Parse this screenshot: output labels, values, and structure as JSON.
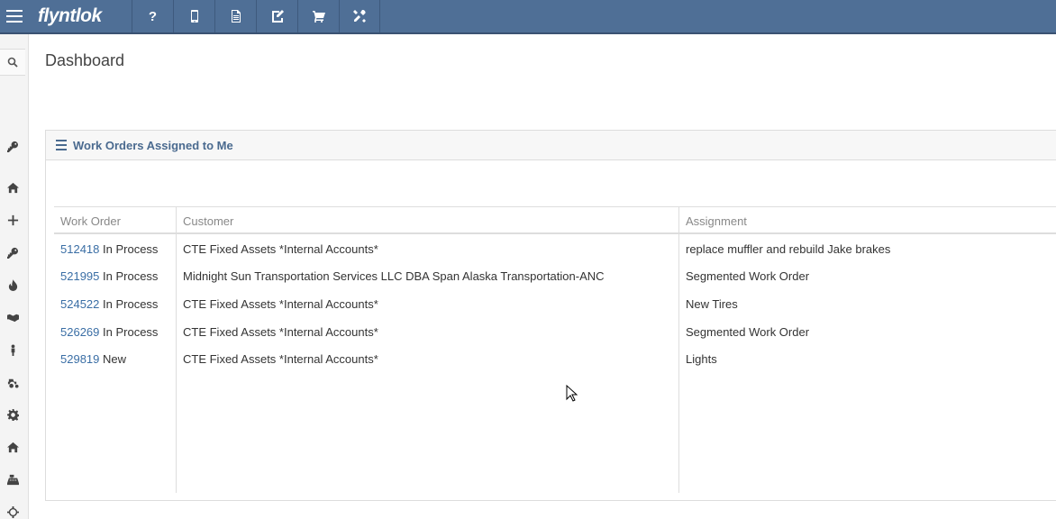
{
  "app": {
    "brand": "flyntlok"
  },
  "topnav": {
    "items": [
      {
        "name": "help",
        "label": "?"
      },
      {
        "name": "mobile",
        "label": ""
      },
      {
        "name": "document",
        "label": ""
      },
      {
        "name": "edit-document",
        "label": ""
      },
      {
        "name": "cart",
        "label": ""
      },
      {
        "name": "tools",
        "label": ""
      }
    ]
  },
  "page": {
    "title": "Dashboard"
  },
  "panel": {
    "title": "Work Orders Assigned to Me",
    "columns": [
      "Work Order",
      "Customer",
      "Assignment"
    ],
    "rows": [
      {
        "number": "512418",
        "status": "In Process",
        "customer": "CTE Fixed Assets *Internal Accounts*",
        "assignment": "replace muffler and rebuild Jake brakes"
      },
      {
        "number": "521995",
        "status": "In Process",
        "customer": "Midnight Sun Transportation Services LLC DBA Span Alaska Transportation-ANC",
        "assignment": "Segmented Work Order"
      },
      {
        "number": "524522",
        "status": "In Process",
        "customer": "CTE Fixed Assets *Internal Accounts*",
        "assignment": "New Tires"
      },
      {
        "number": "526269",
        "status": "In Process",
        "customer": "CTE Fixed Assets *Internal Accounts*",
        "assignment": "Segmented Work Order"
      },
      {
        "number": "529819",
        "status": "New",
        "customer": "CTE Fixed Assets *Internal Accounts*",
        "assignment": "Lights"
      }
    ]
  },
  "colors": {
    "topbar": "#4f6f96",
    "link": "#3a6ea5",
    "panel_title": "#4a6a8f"
  }
}
